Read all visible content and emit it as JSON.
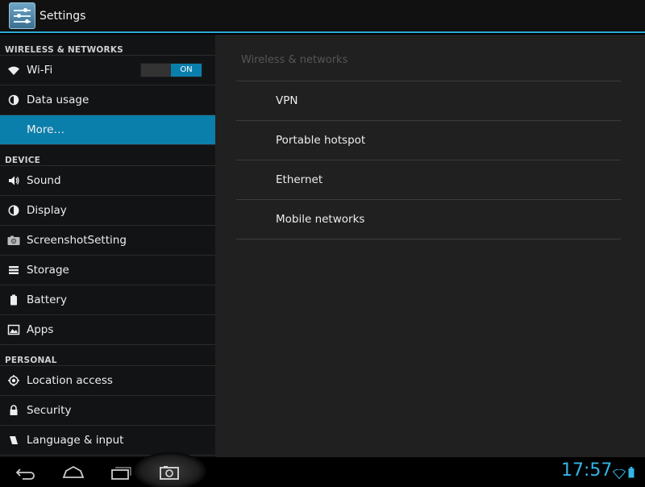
{
  "actionbar": {
    "title": "Settings",
    "icon": "settings-app-icon"
  },
  "sidebar": {
    "sections": [
      {
        "header": "WIRELESS & NETWORKS",
        "items": [
          {
            "label": "Wi-Fi",
            "icon": "wifi-icon",
            "toggle": "ON"
          },
          {
            "label": "Data usage",
            "icon": "data-usage-icon"
          },
          {
            "label": "More…",
            "icon": "",
            "selected": true
          }
        ]
      },
      {
        "header": "DEVICE",
        "items": [
          {
            "label": "Sound",
            "icon": "sound-icon"
          },
          {
            "label": "Display",
            "icon": "display-icon"
          },
          {
            "label": "ScreenshotSetting",
            "icon": "camera-icon"
          },
          {
            "label": "Storage",
            "icon": "storage-icon"
          },
          {
            "label": "Battery",
            "icon": "battery-icon"
          },
          {
            "label": "Apps",
            "icon": "apps-icon"
          }
        ]
      },
      {
        "header": "PERSONAL",
        "items": [
          {
            "label": "Location access",
            "icon": "location-icon"
          },
          {
            "label": "Security",
            "icon": "lock-icon"
          },
          {
            "label": "Language & input",
            "icon": "language-icon"
          }
        ]
      }
    ]
  },
  "content": {
    "header": "Wireless & networks",
    "items": [
      "VPN",
      "Portable hotspot",
      "Ethernet",
      "Mobile networks"
    ]
  },
  "navbar": {
    "buttons": [
      "back-icon",
      "home-icon",
      "recent-apps-icon",
      "screenshot-icon"
    ],
    "clock": "17:57",
    "accent": "#33b5e5"
  }
}
